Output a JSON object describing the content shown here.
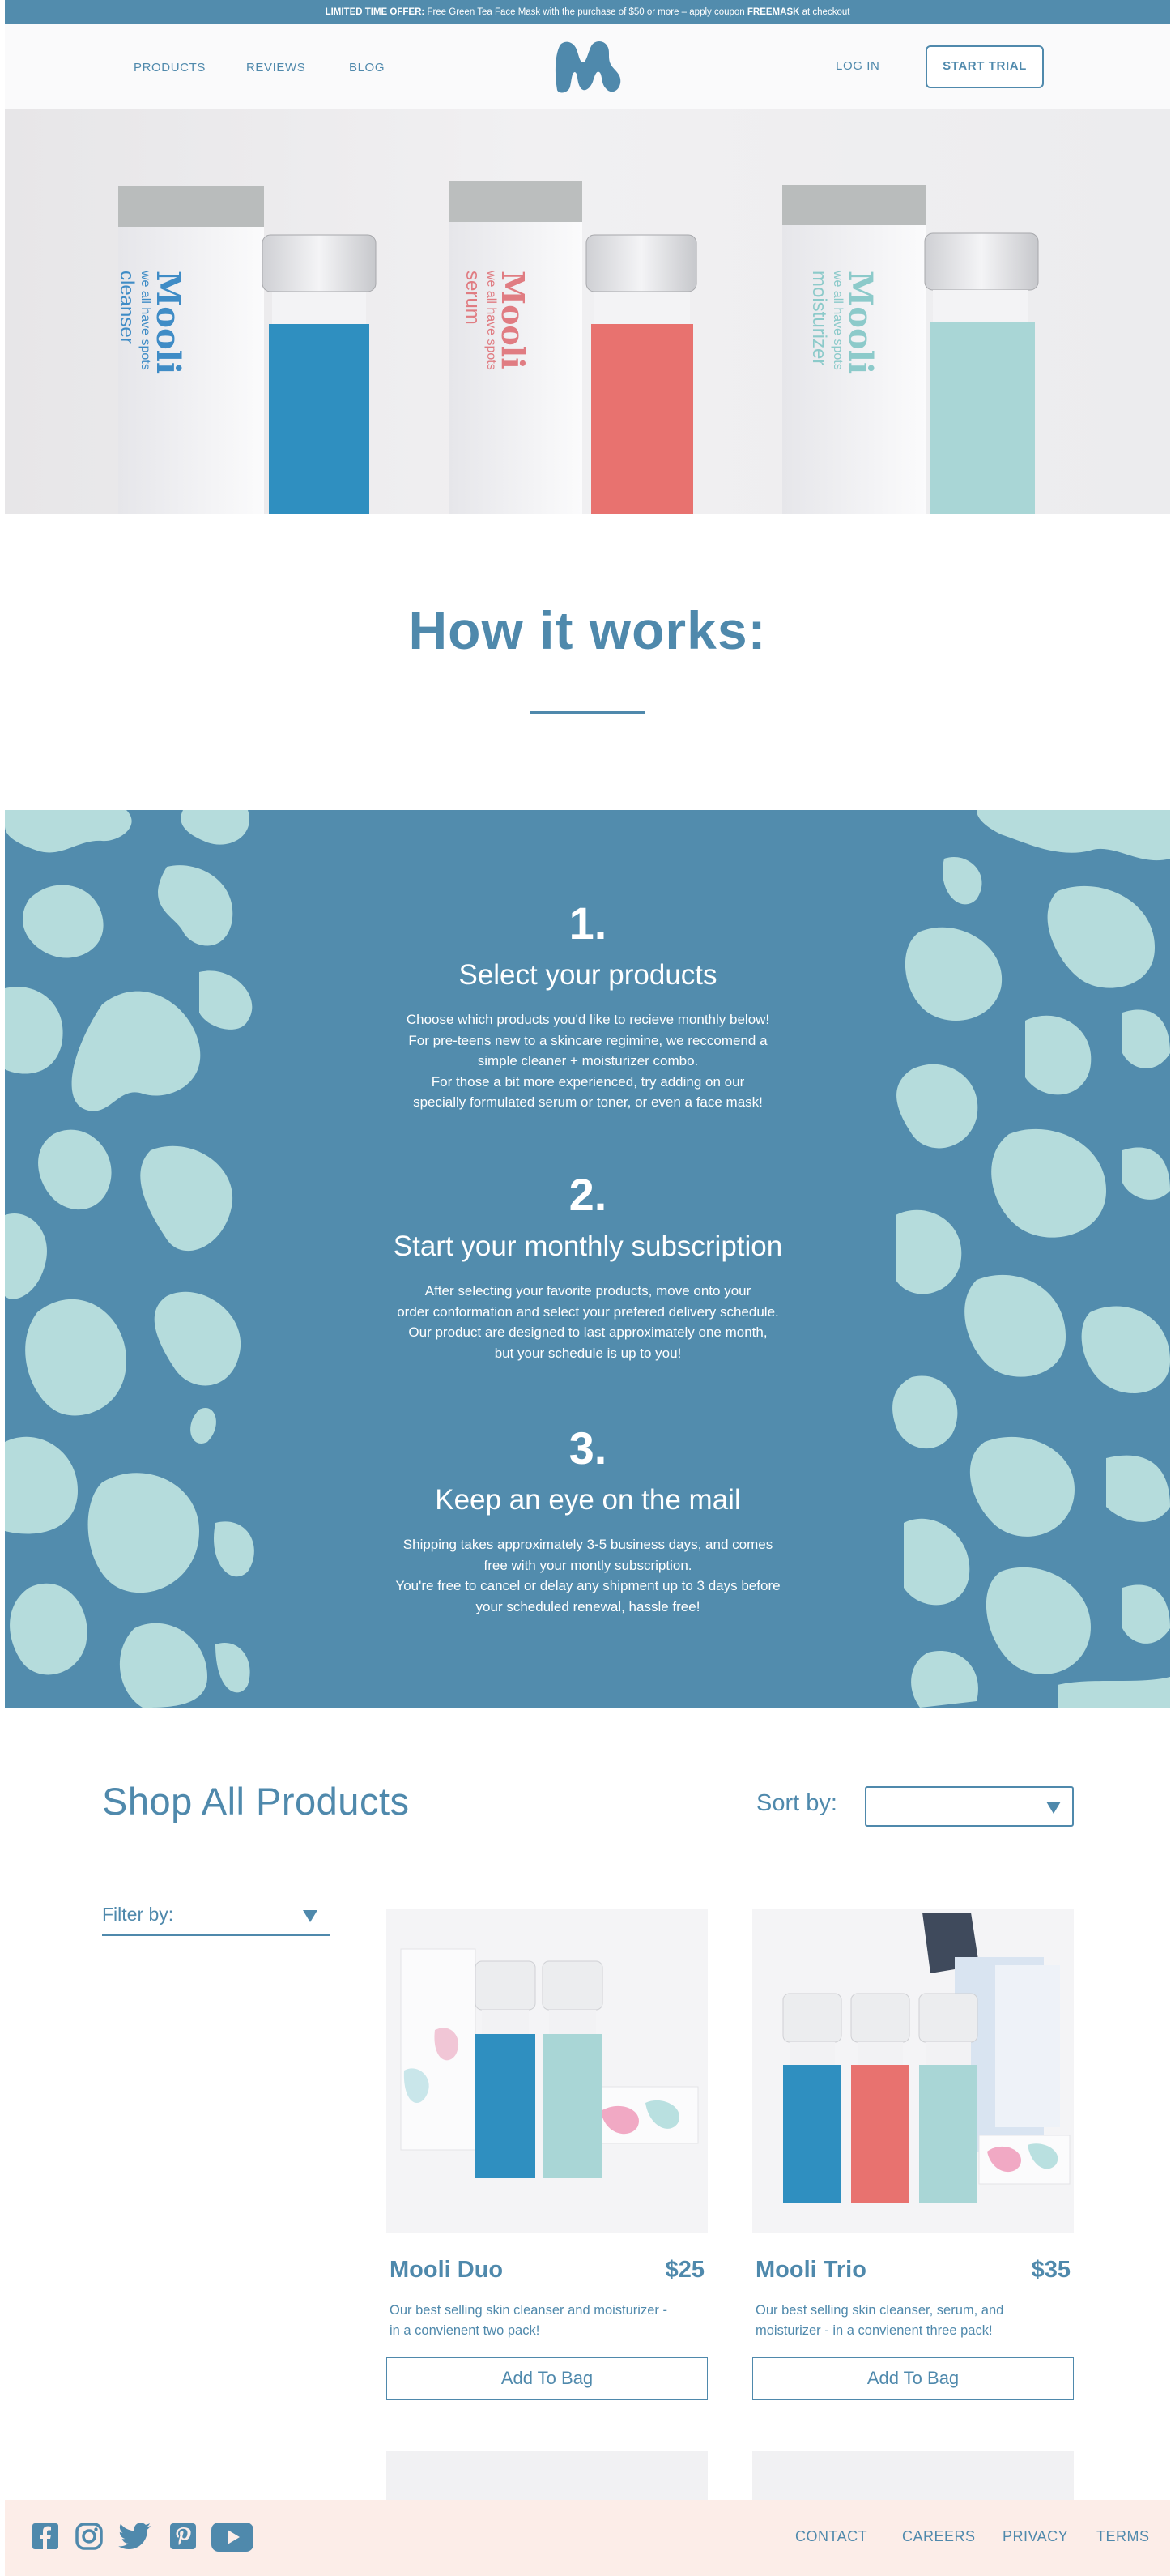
{
  "promo": {
    "lead": "LIMITED TIME OFFER:",
    "text": " Free Green Tea Face Mask with the purchase of $50 or more – apply coupon ",
    "code": "FREEMASK",
    "tail": " at checkout"
  },
  "nav": {
    "products": "PRODUCTS",
    "reviews": "REVIEWS",
    "blog": "BLOG",
    "login": "LOG IN",
    "start_trial": "START TRIAL"
  },
  "hero": {
    "boxes": [
      {
        "brand": "Mooli",
        "tagline": "we all have spots",
        "product": "cleanser",
        "bottle_color": "#2f8fc0",
        "brand_color": "#3f8cc6"
      },
      {
        "brand": "Mooli",
        "tagline": "we all have spots",
        "product": "serum",
        "bottle_color": "#e8726f",
        "brand_color": "#e07c82"
      },
      {
        "brand": "Mooli",
        "tagline": "we all have spots",
        "product": "moisturizer",
        "bottle_color": "#a9d6d6",
        "brand_color": "#8ccaca"
      }
    ]
  },
  "how": {
    "title": "How it works:"
  },
  "steps": [
    {
      "number": "1.",
      "title": "Select your products",
      "lines": [
        "Choose which products you'd like to recieve monthly below!",
        "For pre-teens new to a skincare regimine, we reccomend a",
        "simple cleaner + moisturizer combo.",
        "For those a bit more experienced, try adding on our",
        "specially formulated serum or toner, or even a face mask!"
      ]
    },
    {
      "number": "2.",
      "title": "Start your monthly subscription",
      "lines": [
        "After selecting your favorite products, move onto your",
        "order conformation and select your prefered delivery schedule.",
        "Our product are designed to last approximately one month,",
        "but your schedule is up to you!"
      ]
    },
    {
      "number": "3.",
      "title": "Keep an eye on the mail",
      "lines": [
        "Shipping takes approximately 3-5 business days, and comes",
        "free with your montly subscription.",
        "You're free to cancel or delay any shipment up to 3 days before",
        "your scheduled renewal, hassle free!"
      ]
    }
  ],
  "shop": {
    "title": "Shop All Products",
    "sort_label": "Sort by:",
    "sort_value": "",
    "filter_label": "Filter by:"
  },
  "products": [
    {
      "name": "Mooli Duo",
      "price": "$25",
      "desc_lines": [
        "Our best selling skin cleanser and moisturizer -",
        "in a convienent two pack!"
      ],
      "button": "Add To Bag",
      "bottles": [
        {
          "label": "cleanser",
          "color": "#2f8fc0"
        },
        {
          "label": "moisturizer",
          "color": "#a9d6d6"
        }
      ]
    },
    {
      "name": "Mooli Trio",
      "price": "$35",
      "desc_lines": [
        "Our best selling skin cleanser, serum, and",
        "moisturizer - in a convienent three pack!"
      ],
      "button": "Add To Bag",
      "bottles": [
        {
          "label": "cleanser",
          "color": "#2f8fc0"
        },
        {
          "label": "serum",
          "color": "#e8726f"
        },
        {
          "label": "moisturizer",
          "color": "#a9d6d6"
        }
      ]
    }
  ],
  "footer": {
    "social": [
      "facebook-icon",
      "instagram-icon",
      "twitter-icon",
      "pinterest-icon",
      "youtube-icon"
    ],
    "contact": "CONTACT",
    "careers": "CAREERS",
    "privacy": "PRIVACY",
    "terms": "TERMS"
  },
  "colors": {
    "brand_blue": "#528cad",
    "text_blue": "#4f89ac",
    "spot_mint": "#b5dcdc",
    "footer_bg": "#fcede8"
  }
}
